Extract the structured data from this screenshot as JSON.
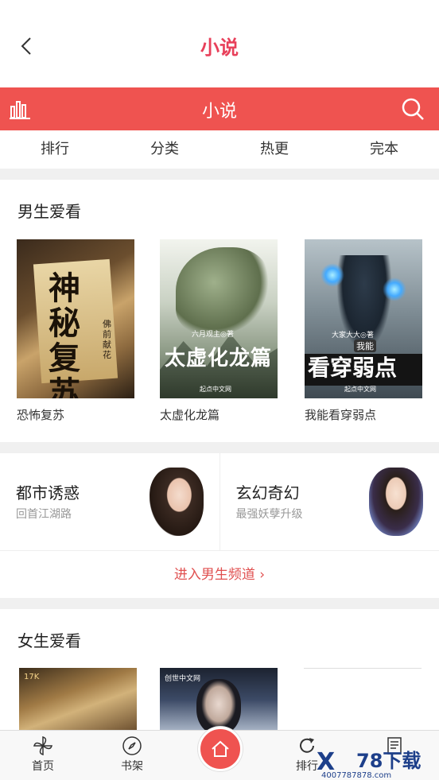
{
  "header": {
    "title": "小说"
  },
  "channel_bar": {
    "title": "小说",
    "accent": "#ef5350"
  },
  "tabs": [
    {
      "label": "排行"
    },
    {
      "label": "分类"
    },
    {
      "label": "热更"
    },
    {
      "label": "完本"
    }
  ],
  "male_section": {
    "title": "男生爱看",
    "books": [
      {
        "title": "恐怖复苏",
        "cover_text": "神秘复苏",
        "cover_author": "佛前献花"
      },
      {
        "title": "太虚化龙篇",
        "cover_text": "太虚化龙篇",
        "cover_author": "六月观主◎著"
      },
      {
        "title": "我能看穿弱点",
        "cover_text": "看穿弱点",
        "cover_sub": "我能",
        "cover_author": "大家大大◎著"
      }
    ],
    "publisher": "起点中文网"
  },
  "genres": [
    {
      "name": "都市诱惑",
      "sub": "回首江湖路"
    },
    {
      "name": "玄幻奇幻",
      "sub": "最强妖孽升级"
    }
  ],
  "enter_link": "进入男生频道 ›",
  "female_section": {
    "title": "女生爱看",
    "covers": [
      {
        "logo": "17K"
      },
      {
        "logo": "创世中文网"
      }
    ]
  },
  "bottom_nav": {
    "home": "首页",
    "shelf": "书架",
    "rank": "排行"
  },
  "watermark": {
    "logo": "78下载",
    "url": "4007787878.com"
  }
}
